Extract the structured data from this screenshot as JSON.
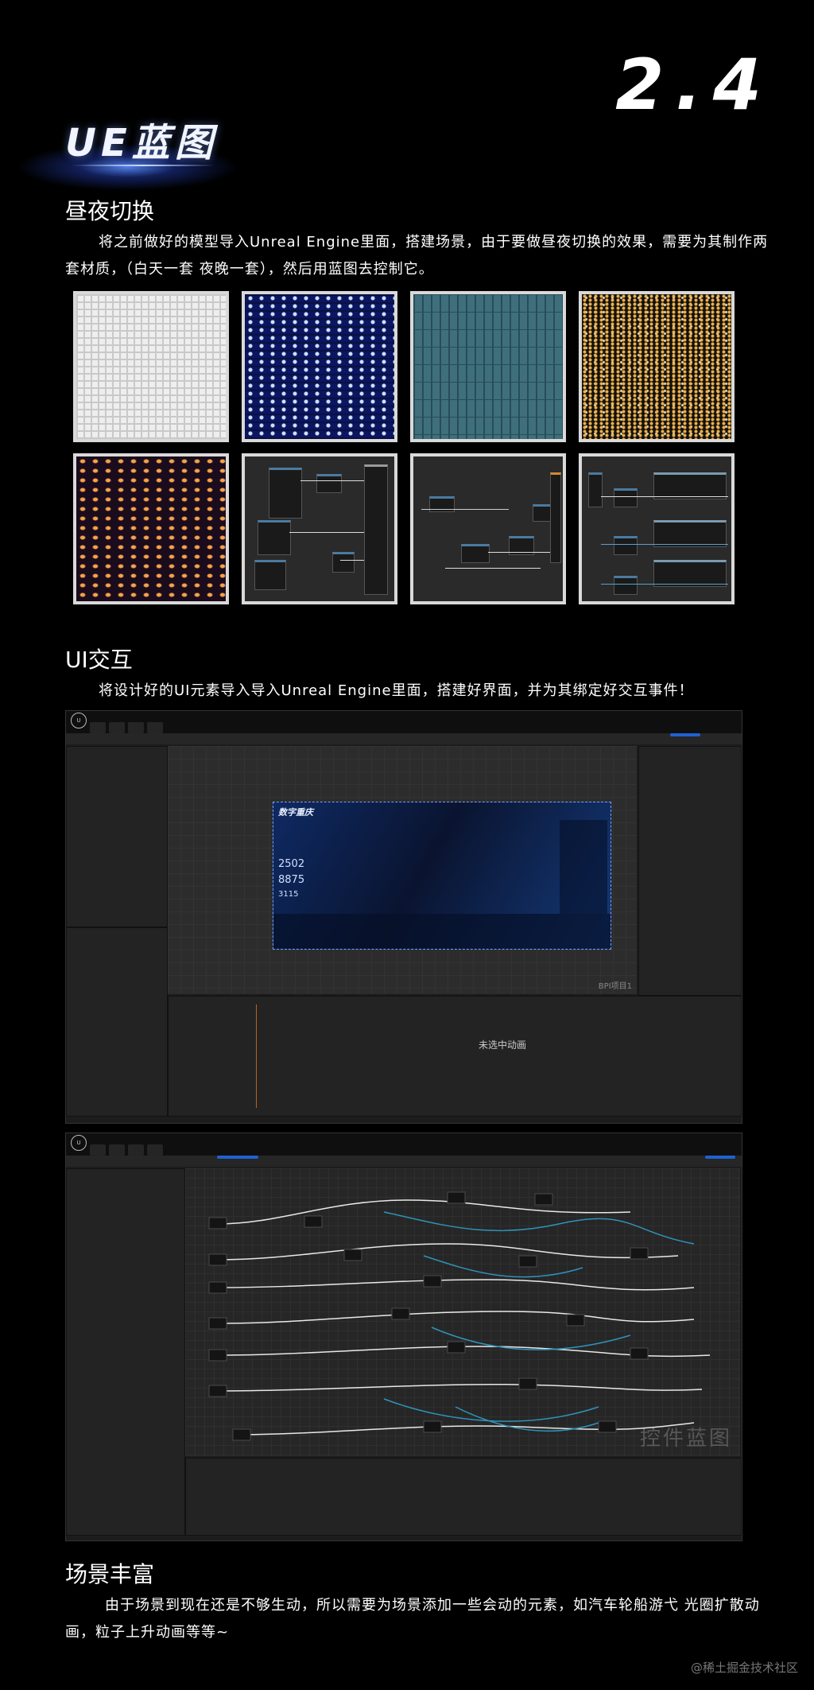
{
  "header": {
    "section_number": "2.4",
    "title": "UE蓝图"
  },
  "section_day_night": {
    "heading": "昼夜切换",
    "body_line1": "将之前做好的模型导入Unreal Engine里面，搭建场景，由于要做昼夜切换的效果，需要为其制作两",
    "body_line2": "套材质，（白天一套 夜晚一套），然后用蓝图去控制它。",
    "tiles": [
      "white-window-texture",
      "blue-night-window-texture",
      "teal-glass-facade-texture",
      "dark-facade-lit-windows-texture",
      "purple-night-lit-windows-texture",
      "material-node-graph",
      "blueprint-node-graph",
      "blueprint-node-graph-wide"
    ]
  },
  "section_ui": {
    "heading": "UI交互",
    "body": "将设计好的UI元素导入导入Unreal Engine里面，搭建好界面，并为其绑定好交互事件！",
    "window1": {
      "anim_placeholder": "未选中动画",
      "dashboard_title": "数字重庆",
      "watermark": "BPI项目1",
      "number1": "2502",
      "number2": "8875",
      "number3": "3115"
    },
    "window2": {
      "watermark": "控件蓝图"
    }
  },
  "section_scene": {
    "heading": "场景丰富",
    "body_line1": "由于场景到现在还是不够生动，所以需要为场景添加一些会动的元素，如汽车轮船游弋 光圈扩散动",
    "body_line2": "画，粒子上升动画等等~"
  },
  "footer": {
    "credit": "@稀土掘金技术社区"
  }
}
